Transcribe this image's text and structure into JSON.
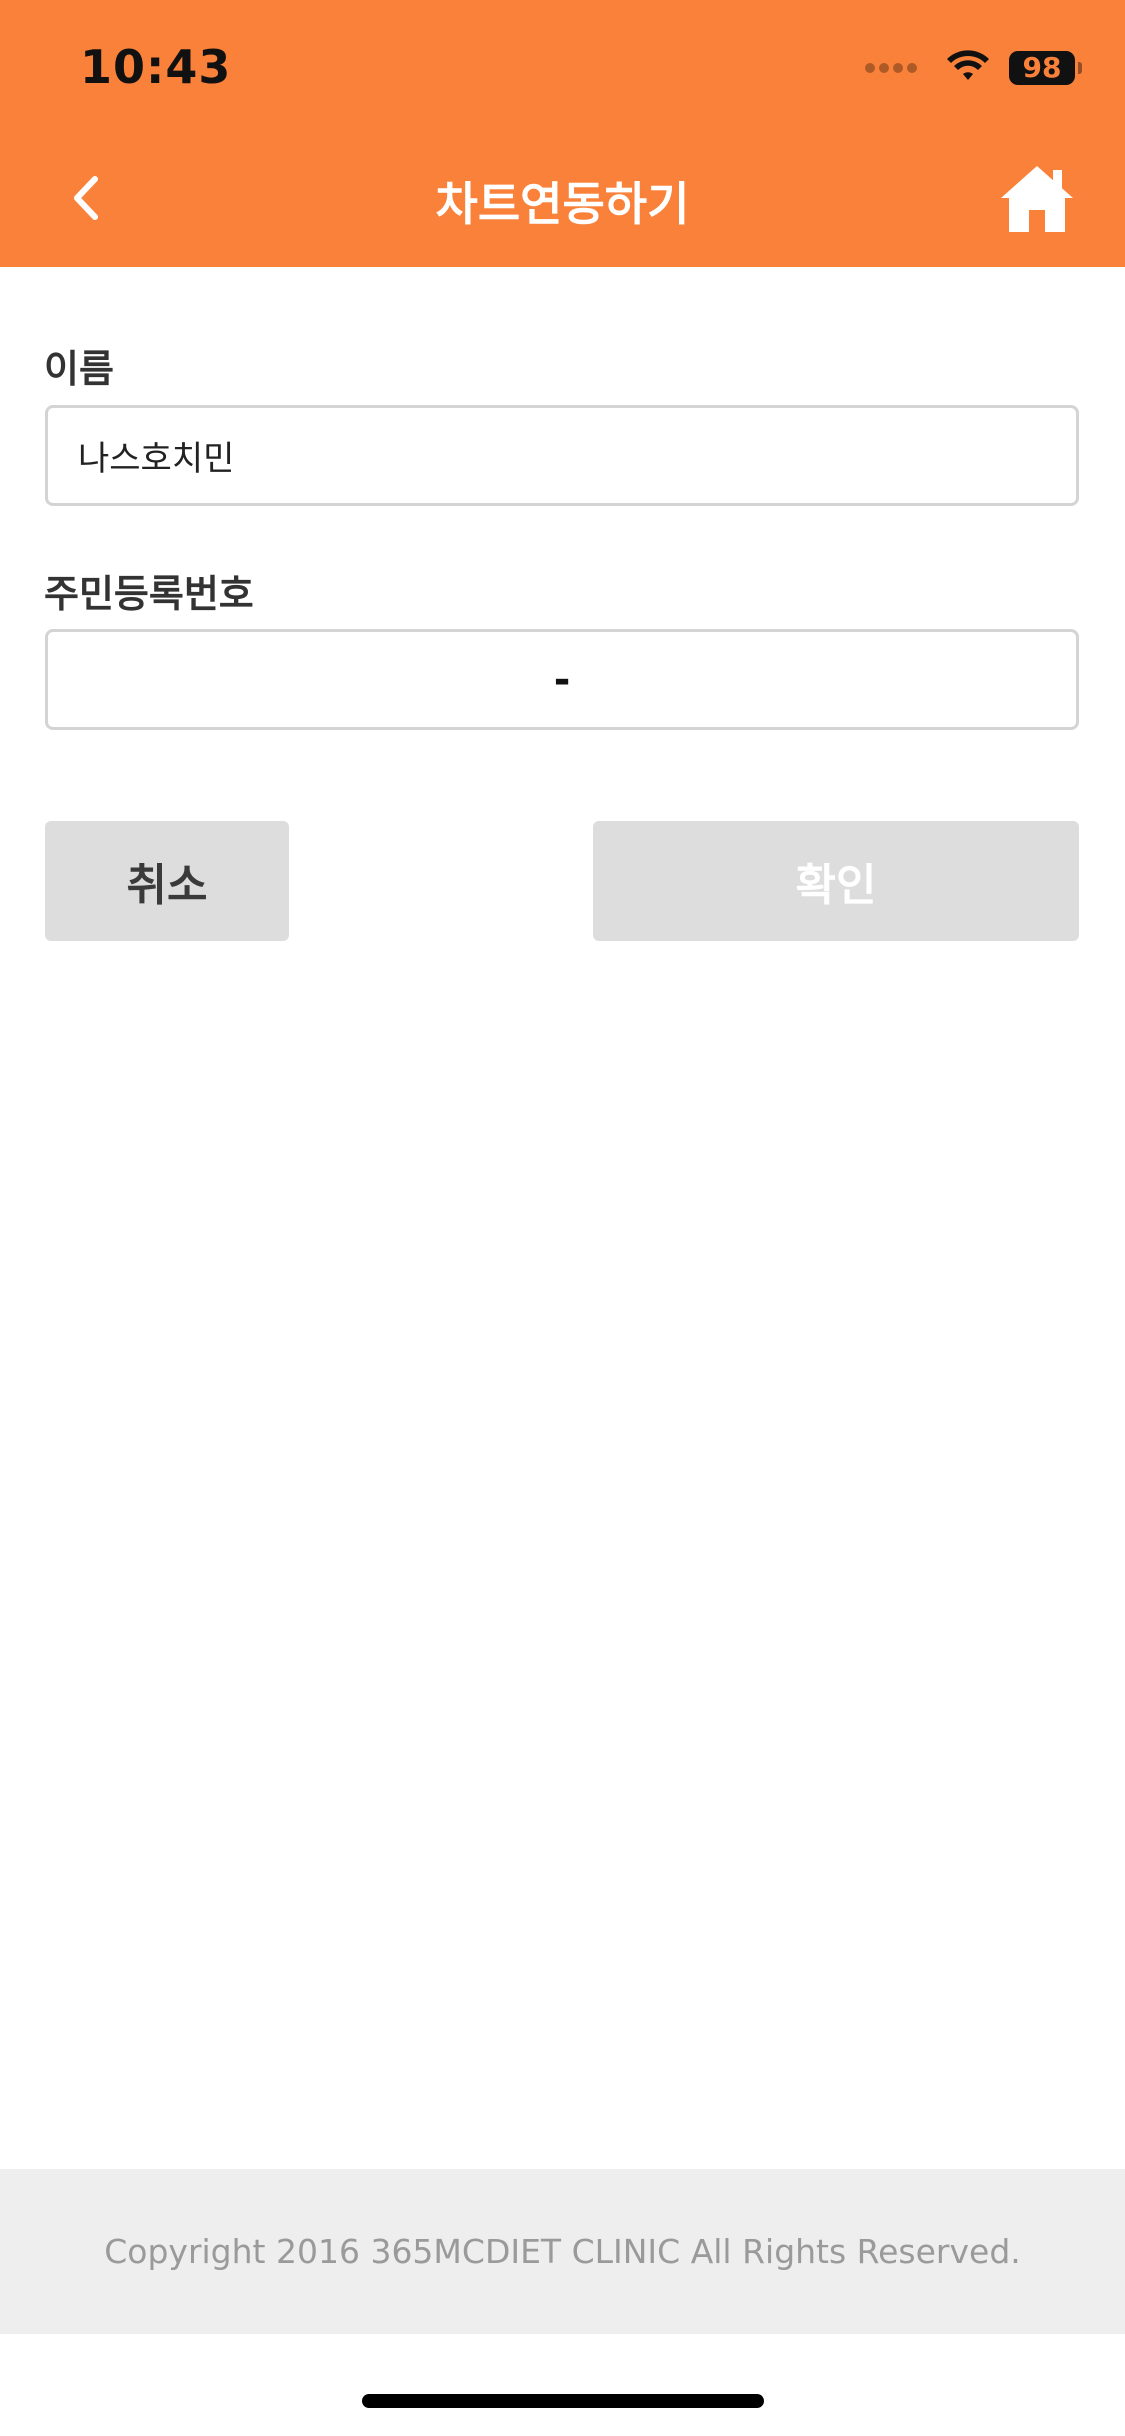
{
  "colors": {
    "header_bg": "#f98139",
    "button_bg": "#dddddd",
    "footer_bg": "#eeeeee"
  },
  "status_bar": {
    "time": "10:43",
    "battery": "98",
    "icons": [
      "signal-dots-icon",
      "wifi-icon",
      "battery-icon"
    ]
  },
  "nav": {
    "title": "차트연동하기",
    "back_icon": "chevron-left-icon",
    "home_icon": "home-icon"
  },
  "form": {
    "name_label": "이름",
    "name_value": "나스호치민",
    "ssn_label": "주민등록번호",
    "ssn_front": "",
    "ssn_separator": "-",
    "ssn_back": ""
  },
  "buttons": {
    "cancel": "취소",
    "confirm": "확인"
  },
  "footer": {
    "copyright": "Copyright 2016 365MCDIET CLINIC All Rights Reserved."
  }
}
